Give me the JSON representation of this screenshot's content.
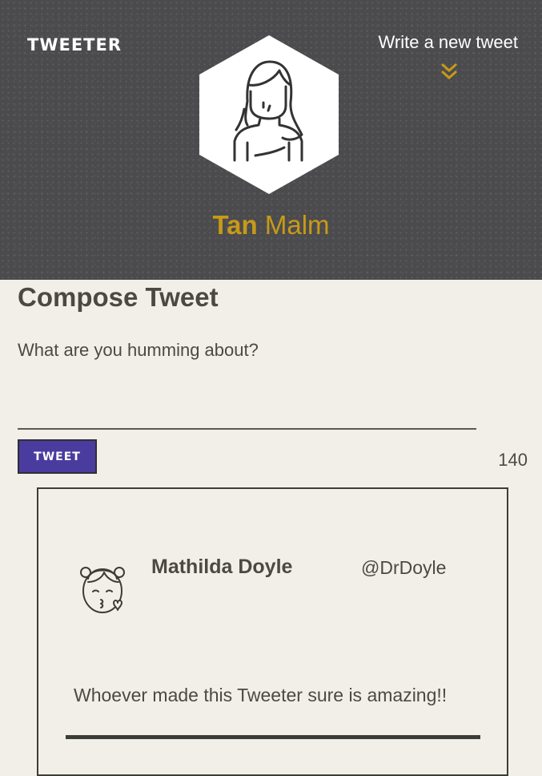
{
  "header": {
    "brand": "TWEETER",
    "nav_write": "Write a new tweet",
    "chevron_icon": "double-chevron-down-icon",
    "profile_avatar_icon": "woman-avatar-icon",
    "profile_first_name": "Tan",
    "profile_last_name": "Malm"
  },
  "compose": {
    "title": "Compose Tweet",
    "placeholder": "What are you humming about?",
    "button_label": "TWEET",
    "counter": "140"
  },
  "tweets": [
    {
      "avatar_icon": "girl-blowing-kiss-avatar-icon",
      "name": "Mathilda Doyle",
      "handle": "@DrDoyle",
      "text": "Whoever made this Tweeter sure is amazing!!"
    }
  ],
  "colors": {
    "header_bg": "#4b4b4e",
    "page_bg": "#f2efe9",
    "accent_gold": "#c79a16",
    "button_purple": "#4a3c9e",
    "text_dark": "#4a4a43"
  }
}
